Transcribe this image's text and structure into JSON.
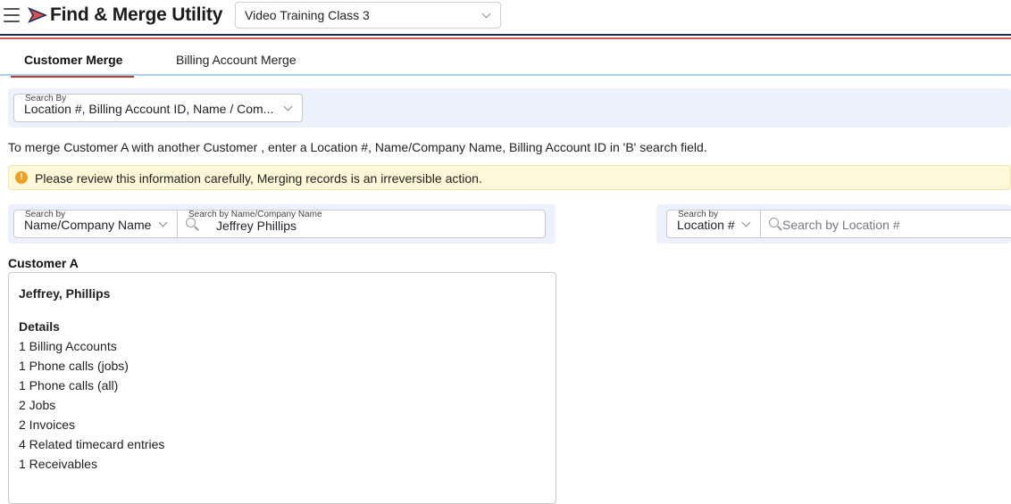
{
  "header": {
    "app_title": "Find & Merge Utility",
    "account_selector": "Video Training Class 3",
    "colors": {
      "navy": "#1e2a5a",
      "red": "#d9534f",
      "accent_blue": "#a8d1f0"
    }
  },
  "tabs": [
    {
      "label": "Customer Merge",
      "active": true
    },
    {
      "label": "Billing Account Merge",
      "active": false
    }
  ],
  "search_by": {
    "label": "Search By",
    "value": "Location #, Billing Account ID, Name / Com..."
  },
  "instruction": "To merge Customer A with another Customer , enter a Location #, Name/Company Name, Billing Account ID in 'B' search field.",
  "warning": {
    "icon": "exclamation-circle-icon",
    "text": "Please review this information carefully, Merging records is an irreversible action."
  },
  "search_a": {
    "type_label": "Search by",
    "type_value": "Name/Company Name",
    "input_label": "Search by Name/Company Name",
    "input_value": "Jeffrey Phillips"
  },
  "search_b": {
    "type_label": "Search by",
    "type_value": "Location #",
    "input_placeholder": "Search by Location #"
  },
  "customer_a": {
    "heading": "Customer A",
    "name": "Jeffrey, Phillips",
    "details_heading": "Details",
    "details": [
      "1 Billing Accounts",
      "1 Phone calls (jobs)",
      "1 Phone calls (all)",
      "2 Jobs",
      "2 Invoices",
      "4 Related timecard entries",
      "1 Receivables"
    ]
  }
}
